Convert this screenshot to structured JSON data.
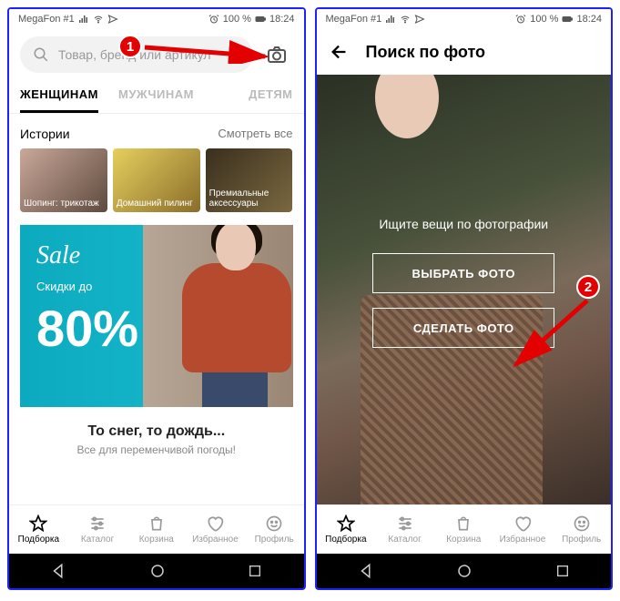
{
  "statusbar": {
    "carrier": "MegaFon #1",
    "battery": "100 %",
    "time": "18:24"
  },
  "screen1": {
    "search_placeholder": "Товар, бренд или артикул",
    "tabs": {
      "women": "ЖЕНЩИНАМ",
      "men": "МУЖЧИНАМ",
      "kids": "ДЕТЯМ"
    },
    "stories": {
      "title": "Истории",
      "view_all": "Смотреть все",
      "items": [
        {
          "label": "Шопинг: трикотаж"
        },
        {
          "label": "Домашний пилинг"
        },
        {
          "label": "Премиальные аксессуары"
        }
      ]
    },
    "banner": {
      "sale": "Sale",
      "sub": "Скидки до",
      "pct": "80%"
    },
    "headline": {
      "title": "То снег, то дождь...",
      "sub": "Все для переменчивой погоды!"
    }
  },
  "screen2": {
    "title": "Поиск по фото",
    "hint": "Ищите вещи по фотографии",
    "choose_btn": "ВЫБРАТЬ ФОТО",
    "take_btn": "СДЕЛАТЬ ФОТО"
  },
  "nav": {
    "items": [
      {
        "label": "Подборка"
      },
      {
        "label": "Каталог"
      },
      {
        "label": "Корзина"
      },
      {
        "label": "Избранное"
      },
      {
        "label": "Профиль"
      }
    ]
  },
  "annotations": {
    "badge1": "1",
    "badge2": "2"
  }
}
